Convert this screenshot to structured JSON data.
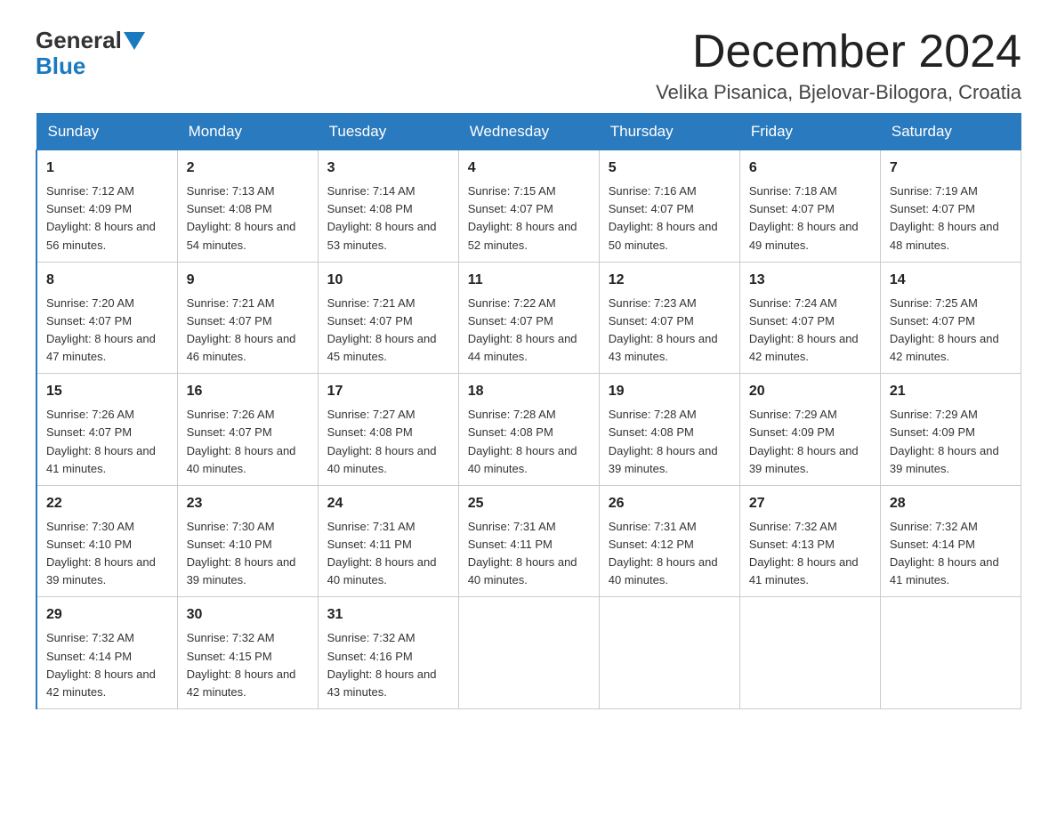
{
  "header": {
    "logo_general": "General",
    "logo_blue": "Blue",
    "month_title": "December 2024",
    "location": "Velika Pisanica, Bjelovar-Bilogora, Croatia"
  },
  "weekdays": [
    "Sunday",
    "Monday",
    "Tuesday",
    "Wednesday",
    "Thursday",
    "Friday",
    "Saturday"
  ],
  "weeks": [
    [
      {
        "day": "1",
        "sunrise": "7:12 AM",
        "sunset": "4:09 PM",
        "daylight": "8 hours and 56 minutes."
      },
      {
        "day": "2",
        "sunrise": "7:13 AM",
        "sunset": "4:08 PM",
        "daylight": "8 hours and 54 minutes."
      },
      {
        "day": "3",
        "sunrise": "7:14 AM",
        "sunset": "4:08 PM",
        "daylight": "8 hours and 53 minutes."
      },
      {
        "day": "4",
        "sunrise": "7:15 AM",
        "sunset": "4:07 PM",
        "daylight": "8 hours and 52 minutes."
      },
      {
        "day": "5",
        "sunrise": "7:16 AM",
        "sunset": "4:07 PM",
        "daylight": "8 hours and 50 minutes."
      },
      {
        "day": "6",
        "sunrise": "7:18 AM",
        "sunset": "4:07 PM",
        "daylight": "8 hours and 49 minutes."
      },
      {
        "day": "7",
        "sunrise": "7:19 AM",
        "sunset": "4:07 PM",
        "daylight": "8 hours and 48 minutes."
      }
    ],
    [
      {
        "day": "8",
        "sunrise": "7:20 AM",
        "sunset": "4:07 PM",
        "daylight": "8 hours and 47 minutes."
      },
      {
        "day": "9",
        "sunrise": "7:21 AM",
        "sunset": "4:07 PM",
        "daylight": "8 hours and 46 minutes."
      },
      {
        "day": "10",
        "sunrise": "7:21 AM",
        "sunset": "4:07 PM",
        "daylight": "8 hours and 45 minutes."
      },
      {
        "day": "11",
        "sunrise": "7:22 AM",
        "sunset": "4:07 PM",
        "daylight": "8 hours and 44 minutes."
      },
      {
        "day": "12",
        "sunrise": "7:23 AM",
        "sunset": "4:07 PM",
        "daylight": "8 hours and 43 minutes."
      },
      {
        "day": "13",
        "sunrise": "7:24 AM",
        "sunset": "4:07 PM",
        "daylight": "8 hours and 42 minutes."
      },
      {
        "day": "14",
        "sunrise": "7:25 AM",
        "sunset": "4:07 PM",
        "daylight": "8 hours and 42 minutes."
      }
    ],
    [
      {
        "day": "15",
        "sunrise": "7:26 AM",
        "sunset": "4:07 PM",
        "daylight": "8 hours and 41 minutes."
      },
      {
        "day": "16",
        "sunrise": "7:26 AM",
        "sunset": "4:07 PM",
        "daylight": "8 hours and 40 minutes."
      },
      {
        "day": "17",
        "sunrise": "7:27 AM",
        "sunset": "4:08 PM",
        "daylight": "8 hours and 40 minutes."
      },
      {
        "day": "18",
        "sunrise": "7:28 AM",
        "sunset": "4:08 PM",
        "daylight": "8 hours and 40 minutes."
      },
      {
        "day": "19",
        "sunrise": "7:28 AM",
        "sunset": "4:08 PM",
        "daylight": "8 hours and 39 minutes."
      },
      {
        "day": "20",
        "sunrise": "7:29 AM",
        "sunset": "4:09 PM",
        "daylight": "8 hours and 39 minutes."
      },
      {
        "day": "21",
        "sunrise": "7:29 AM",
        "sunset": "4:09 PM",
        "daylight": "8 hours and 39 minutes."
      }
    ],
    [
      {
        "day": "22",
        "sunrise": "7:30 AM",
        "sunset": "4:10 PM",
        "daylight": "8 hours and 39 minutes."
      },
      {
        "day": "23",
        "sunrise": "7:30 AM",
        "sunset": "4:10 PM",
        "daylight": "8 hours and 39 minutes."
      },
      {
        "day": "24",
        "sunrise": "7:31 AM",
        "sunset": "4:11 PM",
        "daylight": "8 hours and 40 minutes."
      },
      {
        "day": "25",
        "sunrise": "7:31 AM",
        "sunset": "4:11 PM",
        "daylight": "8 hours and 40 minutes."
      },
      {
        "day": "26",
        "sunrise": "7:31 AM",
        "sunset": "4:12 PM",
        "daylight": "8 hours and 40 minutes."
      },
      {
        "day": "27",
        "sunrise": "7:32 AM",
        "sunset": "4:13 PM",
        "daylight": "8 hours and 41 minutes."
      },
      {
        "day": "28",
        "sunrise": "7:32 AM",
        "sunset": "4:14 PM",
        "daylight": "8 hours and 41 minutes."
      }
    ],
    [
      {
        "day": "29",
        "sunrise": "7:32 AM",
        "sunset": "4:14 PM",
        "daylight": "8 hours and 42 minutes."
      },
      {
        "day": "30",
        "sunrise": "7:32 AM",
        "sunset": "4:15 PM",
        "daylight": "8 hours and 42 minutes."
      },
      {
        "day": "31",
        "sunrise": "7:32 AM",
        "sunset": "4:16 PM",
        "daylight": "8 hours and 43 minutes."
      },
      null,
      null,
      null,
      null
    ]
  ]
}
